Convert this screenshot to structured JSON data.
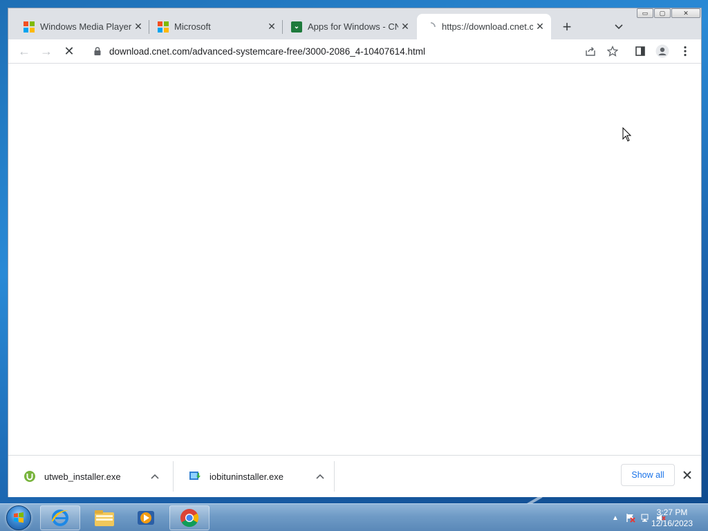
{
  "browser": {
    "tabs": [
      {
        "title": "Windows Media Player e",
        "favicon": "microsoft-logo-icon",
        "active": false
      },
      {
        "title": "Microsoft",
        "favicon": "microsoft-logo-icon",
        "active": false
      },
      {
        "title": "Apps for Windows - CNE",
        "favicon": "cnet-download-icon",
        "active": false
      },
      {
        "title": "https://download.cnet.cc",
        "favicon": "loading-spinner-icon",
        "active": true
      }
    ],
    "new_tab_label": "+",
    "window_controls": {
      "minimize": "▭",
      "maximize": "▢",
      "close": "✕"
    },
    "toolbar": {
      "back_icon": "←",
      "forward_icon": "→",
      "stop_icon": "✕",
      "url": "download.cnet.com/advanced-systemcare-free/3000-2086_4-10407614.html"
    }
  },
  "downloads": {
    "items": [
      {
        "filename": "utweb_installer.exe",
        "icon": "utorrent-icon"
      },
      {
        "filename": "iobituninstaller.exe",
        "icon": "iobit-installer-icon"
      }
    ],
    "show_all_label": "Show all"
  },
  "taskbar": {
    "clock_time": "3:27 PM",
    "clock_date": "12/16/2023",
    "pinned": [
      "internet-explorer-icon",
      "file-explorer-icon",
      "media-player-icon",
      "chrome-icon"
    ]
  },
  "colors": {
    "accent_blue": "#1a73e8",
    "tab_strip": "#dee1e6",
    "desktop": "#1e6fb5"
  }
}
